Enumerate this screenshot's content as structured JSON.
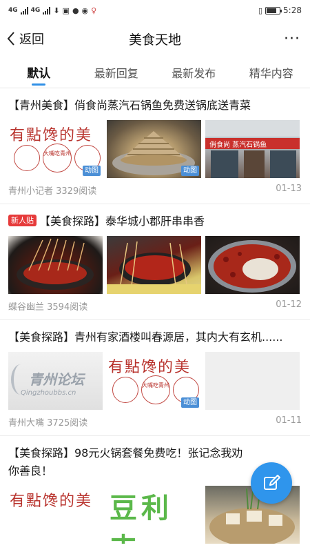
{
  "status_bar": {
    "signal1": "4G",
    "signal2": "4G",
    "time": "5:28"
  },
  "header": {
    "back_label": "返回",
    "title": "美食天地",
    "more_label": "···"
  },
  "tabs": [
    {
      "label": "默认",
      "active": true
    },
    {
      "label": "最新回复",
      "active": false
    },
    {
      "label": "最新发布",
      "active": false
    },
    {
      "label": "精华内容",
      "active": false
    }
  ],
  "posts": [
    {
      "title": "【青州美食】俏食尚蒸汽石锅鱼免费送锅底送青菜",
      "author_reads": "青州小记者 3329阅读",
      "date": "01-13",
      "images": [
        {
          "kind": "logo",
          "logo_text": "有點馋的美",
          "plate_text": "大嘴吃青州",
          "gif": "动图"
        },
        {
          "kind": "photo",
          "gif": "动图"
        },
        {
          "kind": "storefront",
          "sign": "俏食尚 蒸汽石锅鱼"
        }
      ]
    },
    {
      "badge": "新人贴",
      "title": "【美食探路】泰华城小郡肝串串香",
      "author_reads": "蝶谷幽兰 3594阅读",
      "date": "01-12",
      "images": [
        {
          "kind": "photo"
        },
        {
          "kind": "photo"
        },
        {
          "kind": "photo"
        }
      ]
    },
    {
      "title": "【美食探路】青州有家酒楼叫春源居，其内大有玄机......",
      "author_reads": "青州大嘴 3725阅读",
      "date": "01-11",
      "images": [
        {
          "kind": "forum",
          "forum_name": "青州论坛",
          "forum_url": "Qingzhoubbs.cn"
        },
        {
          "kind": "logo",
          "logo_text": "有點馋的美",
          "plate_text": "大嘴吃青州",
          "gif": "动图"
        },
        {
          "kind": "blank"
        }
      ]
    },
    {
      "title": "【美食探路】98元火锅套餐免费吃！张记念我劝你善良！",
      "images": [
        {
          "kind": "logo",
          "logo_text": "有點馋的美"
        },
        {
          "kind": "greenlogo",
          "text": "豆利丰"
        },
        {
          "kind": "photo"
        }
      ]
    }
  ],
  "colors": {
    "accent": "#2f8fe6",
    "badge": "#e63b3b",
    "gif_tag": "#4b8fd6"
  },
  "icons": {
    "back": "chevron-left-icon",
    "more": "more-dots-icon",
    "fab": "edit-icon"
  }
}
